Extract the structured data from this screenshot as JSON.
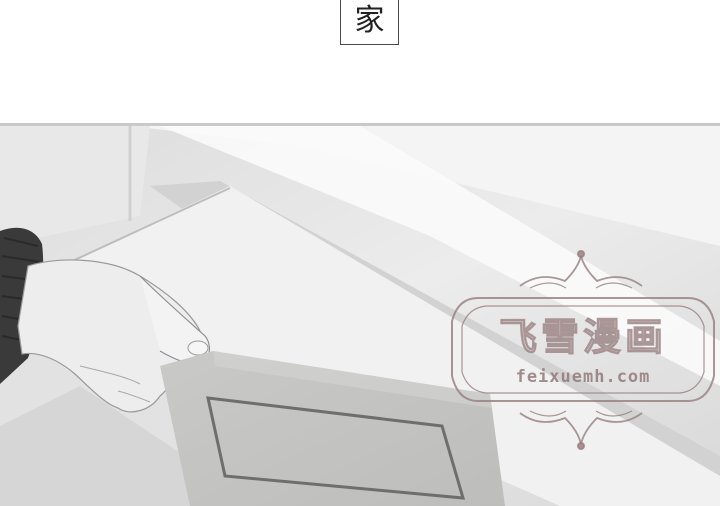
{
  "panel_top": {
    "character": "家"
  },
  "watermark": {
    "brand": "飞雪漫画",
    "url": "feixuemh.com"
  }
}
